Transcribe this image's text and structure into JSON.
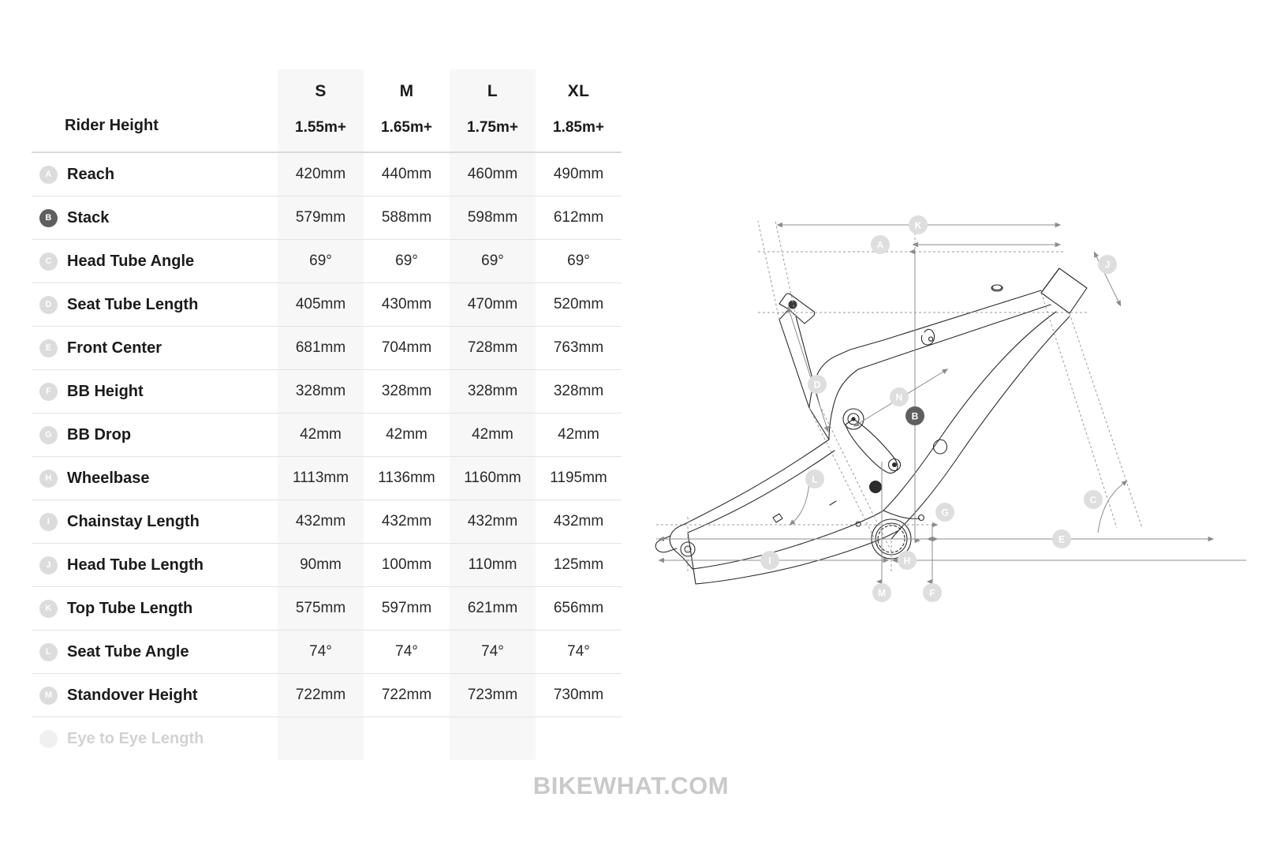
{
  "table": {
    "label_header": "Rider Height",
    "sizes": [
      {
        "name": "S",
        "rider_height": "1.55m+"
      },
      {
        "name": "M",
        "rider_height": "1.65m+"
      },
      {
        "name": "L",
        "rider_height": "1.75m+"
      },
      {
        "name": "XL",
        "rider_height": "1.85m+"
      }
    ],
    "rows": [
      {
        "badge": "A",
        "label": "Reach",
        "values": [
          "420mm",
          "440mm",
          "460mm",
          "490mm"
        ],
        "highlighted": false,
        "muted": false
      },
      {
        "badge": "B",
        "label": "Stack",
        "values": [
          "579mm",
          "588mm",
          "598mm",
          "612mm"
        ],
        "highlighted": true,
        "muted": false
      },
      {
        "badge": "C",
        "label": "Head Tube Angle",
        "values": [
          "69°",
          "69°",
          "69°",
          "69°"
        ],
        "highlighted": false,
        "muted": false
      },
      {
        "badge": "D",
        "label": "Seat Tube Length",
        "values": [
          "405mm",
          "430mm",
          "470mm",
          "520mm"
        ],
        "highlighted": false,
        "muted": false
      },
      {
        "badge": "E",
        "label": "Front Center",
        "values": [
          "681mm",
          "704mm",
          "728mm",
          "763mm"
        ],
        "highlighted": false,
        "muted": false
      },
      {
        "badge": "F",
        "label": "BB Height",
        "values": [
          "328mm",
          "328mm",
          "328mm",
          "328mm"
        ],
        "highlighted": false,
        "muted": false
      },
      {
        "badge": "G",
        "label": "BB Drop",
        "values": [
          "42mm",
          "42mm",
          "42mm",
          "42mm"
        ],
        "highlighted": false,
        "muted": false
      },
      {
        "badge": "H",
        "label": "Wheelbase",
        "values": [
          "1113mm",
          "1136mm",
          "1160mm",
          "1195mm"
        ],
        "highlighted": false,
        "muted": false
      },
      {
        "badge": "I",
        "label": "Chainstay Length",
        "values": [
          "432mm",
          "432mm",
          "432mm",
          "432mm"
        ],
        "highlighted": false,
        "muted": false
      },
      {
        "badge": "J",
        "label": "Head Tube Length",
        "values": [
          "90mm",
          "100mm",
          "110mm",
          "125mm"
        ],
        "highlighted": false,
        "muted": false
      },
      {
        "badge": "K",
        "label": "Top Tube Length",
        "values": [
          "575mm",
          "597mm",
          "621mm",
          "656mm"
        ],
        "highlighted": false,
        "muted": false
      },
      {
        "badge": "L",
        "label": "Seat Tube Angle",
        "values": [
          "74°",
          "74°",
          "74°",
          "74°"
        ],
        "highlighted": false,
        "muted": false
      },
      {
        "badge": "M",
        "label": "Standover Height",
        "values": [
          "722mm",
          "722mm",
          "723mm",
          "730mm"
        ],
        "highlighted": false,
        "muted": false
      },
      {
        "badge": "",
        "label": "Eye to Eye Length",
        "values": [
          "",
          "",
          "",
          ""
        ],
        "highlighted": false,
        "muted": true
      }
    ]
  },
  "watermark": {
    "text": "BIKEWHAT.COM"
  },
  "diagram": {
    "title": "bike-frame-geometry-diagram",
    "callouts": [
      {
        "id": "A",
        "meaning": "Reach",
        "highlighted": false
      },
      {
        "id": "B",
        "meaning": "Stack",
        "highlighted": true
      },
      {
        "id": "C",
        "meaning": "Head Tube Angle",
        "highlighted": false
      },
      {
        "id": "D",
        "meaning": "Seat Tube Length",
        "highlighted": false
      },
      {
        "id": "E",
        "meaning": "Front Center",
        "highlighted": false
      },
      {
        "id": "F",
        "meaning": "BB Height",
        "highlighted": false
      },
      {
        "id": "G",
        "meaning": "BB Drop",
        "highlighted": false
      },
      {
        "id": "H",
        "meaning": "Wheelbase",
        "highlighted": false
      },
      {
        "id": "I",
        "meaning": "Chainstay Length",
        "highlighted": false
      },
      {
        "id": "J",
        "meaning": "Head Tube Length",
        "highlighted": false
      },
      {
        "id": "K",
        "meaning": "Top Tube Length",
        "highlighted": false
      },
      {
        "id": "L",
        "meaning": "Seat Tube Angle",
        "highlighted": false
      },
      {
        "id": "M",
        "meaning": "Standover Height",
        "highlighted": false
      },
      {
        "id": "N",
        "meaning": "Shock Eye to Eye",
        "highlighted": false
      }
    ]
  },
  "colors": {
    "text": "#1b1b1b",
    "value_text": "#2a2a2a",
    "badge_default": "#dcdcdc",
    "badge_highlight": "#5f5f5f",
    "muted": "#d2d2d2",
    "column_shade": "#f7f7f7",
    "row_divider": "#e3e3e3",
    "watermark": "#c9c9c9"
  }
}
